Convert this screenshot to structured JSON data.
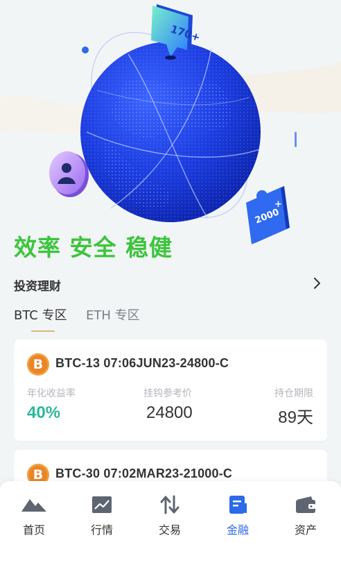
{
  "hero": {
    "badge_top": "170+",
    "badge_bottom": "2000",
    "badge_plus": "+",
    "slogan": "效率 安全 稳健"
  },
  "section": {
    "title": "投资理财"
  },
  "tabs": [
    {
      "label": "BTC 专区",
      "active": true
    },
    {
      "label": "ETH 专区",
      "active": false
    }
  ],
  "products": [
    {
      "coin": "B",
      "name": "BTC-13 07:06JUN23-24800-C",
      "labels": [
        "年化收益率",
        "挂钩参考价",
        "持仓期限"
      ],
      "rate": "40%",
      "price": "24800",
      "term": "89天"
    },
    {
      "coin": "B",
      "name": "BTC-30 07:02MAR23-21000-C"
    }
  ],
  "tabbar": [
    {
      "label": "首页",
      "icon": "mountain-icon",
      "active": false
    },
    {
      "label": "行情",
      "icon": "chart-icon",
      "active": false
    },
    {
      "label": "交易",
      "icon": "swap-icon",
      "active": false
    },
    {
      "label": "金融",
      "icon": "finance-doc-icon",
      "active": true
    },
    {
      "label": "资产",
      "icon": "wallet-icon",
      "active": false
    }
  ],
  "colors": {
    "brand_blue": "#2b6ae8",
    "slogan_green": "#3cc43c",
    "rate_teal": "#2cb89a",
    "coin_orange": "#f7931a"
  }
}
